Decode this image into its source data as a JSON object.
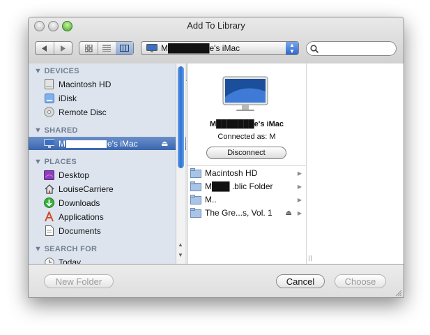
{
  "window": {
    "title": "Add To Library"
  },
  "toolbar": {
    "back_icon": "chevron-left-icon",
    "forward_icon": "chevron-right-icon",
    "view_modes": [
      "icon-view",
      "list-view",
      "column-view"
    ],
    "active_view": "column-view",
    "location": "M███████e's iMac",
    "search_placeholder": ""
  },
  "sidebar": {
    "devices_header": "DEVICES",
    "devices": [
      {
        "label": "Macintosh HD",
        "icon": "hard-drive-icon"
      },
      {
        "label": "iDisk",
        "icon": "idisk-icon"
      },
      {
        "label": "Remote Disc",
        "icon": "disc-icon"
      }
    ],
    "shared_header": "SHARED",
    "shared": [
      {
        "label_prefix": "M",
        "label_suffix": "e's iMac",
        "icon": "imac-icon",
        "selected": true
      }
    ],
    "places_header": "PLACES",
    "places": [
      {
        "label": "Desktop",
        "icon": "desktop-icon"
      },
      {
        "label": "LouiseCarriere",
        "icon": "home-icon"
      },
      {
        "label": "Downloads",
        "icon": "downloads-icon"
      },
      {
        "label": "Applications",
        "icon": "applications-icon"
      },
      {
        "label": "Documents",
        "icon": "documents-icon"
      }
    ],
    "search_header": "SEARCH FOR",
    "search_items": [
      {
        "label": "Today",
        "icon": "clock-icon"
      }
    ]
  },
  "detail": {
    "computer_name": "M███████e's iMac",
    "connected_as": "Connected as: M",
    "disconnect_label": "Disconnect"
  },
  "volumes": [
    {
      "label": "Macintosh HD",
      "ejectable": false
    },
    {
      "label": "M███ .blic Folder",
      "ejectable": false
    },
    {
      "label": "M..",
      "ejectable": false
    },
    {
      "label": "The Gre...s, Vol. 1",
      "ejectable": true
    }
  ],
  "buttons": {
    "new_folder": "New Folder",
    "cancel": "Cancel",
    "choose": "Choose"
  }
}
